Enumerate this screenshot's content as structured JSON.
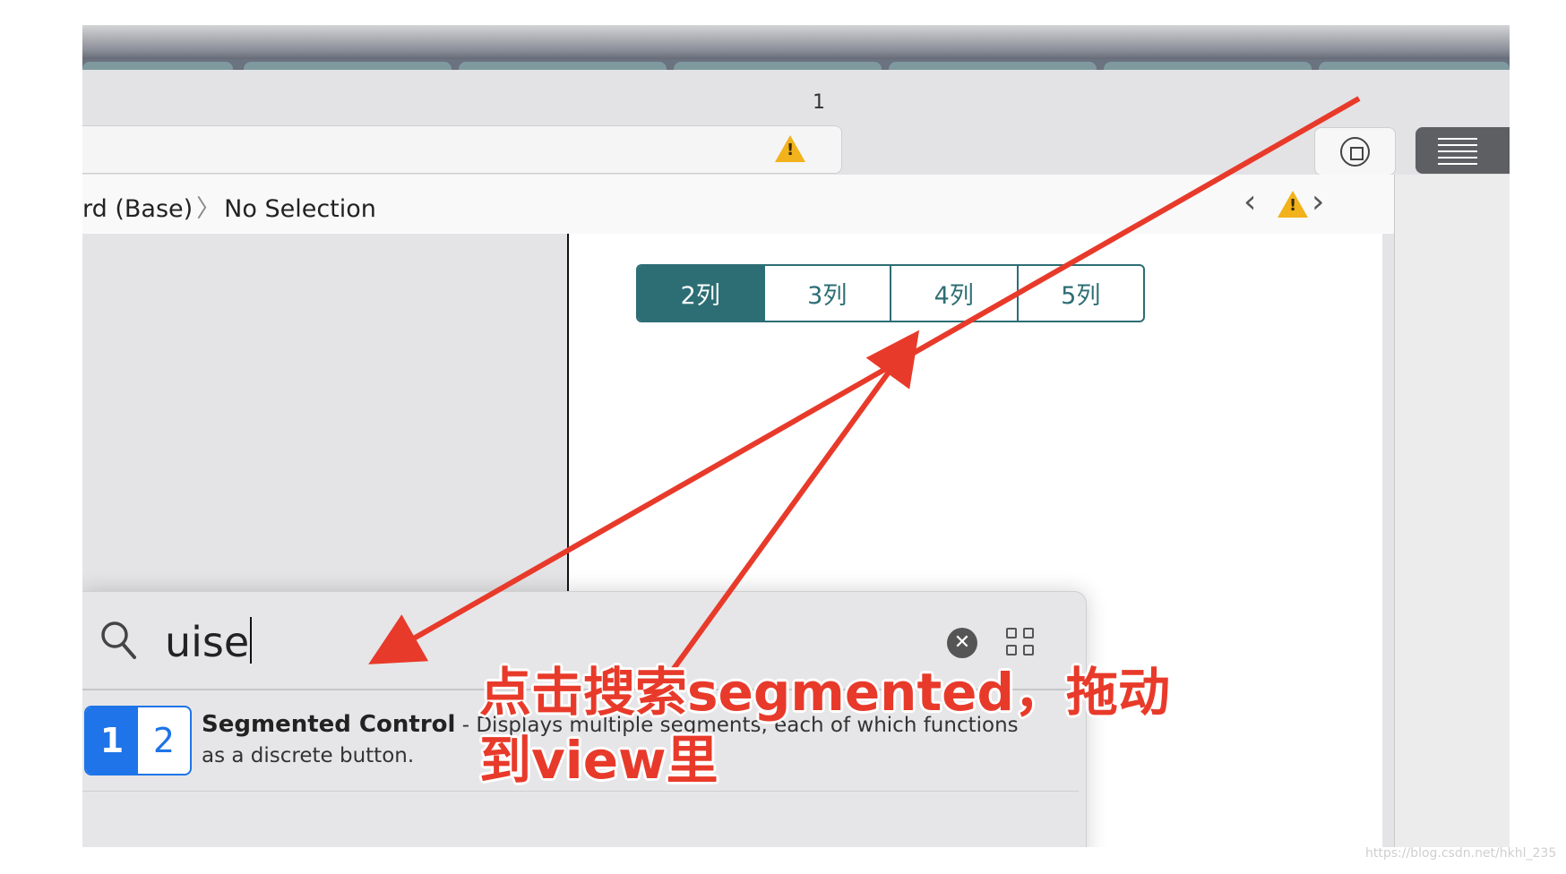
{
  "toolbar": {
    "warning_count": "1",
    "library_button_icon": "library-plus-icon",
    "inspector_button_icon": "inspector-lines-icon"
  },
  "jumpbar": {
    "path_fragment": "rd (Base)",
    "separator": "〉",
    "current": "No Selection",
    "back_glyph": "‹",
    "forward_glyph": "›"
  },
  "segmented_control": {
    "segments": [
      "2列",
      "3列",
      "4列",
      "5列"
    ],
    "selected_index": 0,
    "accent": "#2c6e74"
  },
  "library": {
    "search_value": "uise",
    "clear_glyph": "✕",
    "item": {
      "icon_segments": [
        "1",
        "2"
      ],
      "title": "Segmented Control",
      "desc_line1": " - Displays multiple segments, each of which functions",
      "desc_line2": "as a discrete button."
    },
    "accent": "#1e74e8"
  },
  "annotation": {
    "line1": "点击搜索segmented，拖动",
    "line2": "到view里",
    "color": "#e83a2a"
  },
  "watermark": "https://blog.csdn.net/hkhl_235"
}
